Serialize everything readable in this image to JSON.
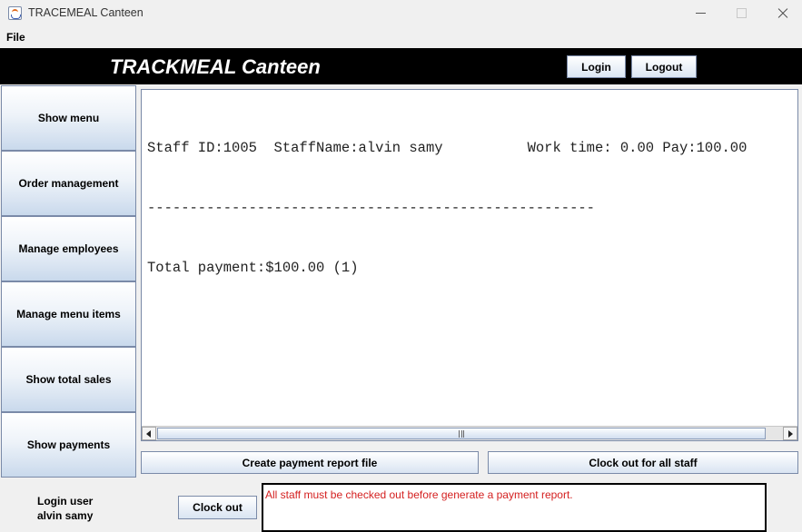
{
  "window": {
    "title": "TRACEMEAL Canteen",
    "icon": "java-cup-icon"
  },
  "menubar": {
    "file_label": "File"
  },
  "header": {
    "title": "TRACKMEAL Canteen",
    "login_label": "Login",
    "logout_label": "Logout"
  },
  "sidebar": {
    "items": [
      {
        "label": "Show menu"
      },
      {
        "label": "Order management"
      },
      {
        "label": "Manage employees"
      },
      {
        "label": "Manage menu items"
      },
      {
        "label": "Show total sales"
      },
      {
        "label": "Show payments"
      }
    ]
  },
  "report": {
    "lines": [
      "Staff ID:1005  StaffName:alvin samy          Work time: 0.00 Pay:100.00",
      "-----------------------------------------------------",
      "Total payment:$100.00 (1)"
    ]
  },
  "actions": {
    "create_report_label": "Create payment report file",
    "clock_out_all_label": "Clock out for all staff"
  },
  "footer": {
    "login_user_label": "Login user",
    "login_user_name": "alvin samy",
    "clock_out_label": "Clock out",
    "message": "All staff must be checked out before generate a payment report."
  },
  "colors": {
    "header_bg": "#000000",
    "button_gradient_top": "#ffffff",
    "button_gradient_bottom": "#c9d9ec",
    "error_text": "#d42020"
  }
}
